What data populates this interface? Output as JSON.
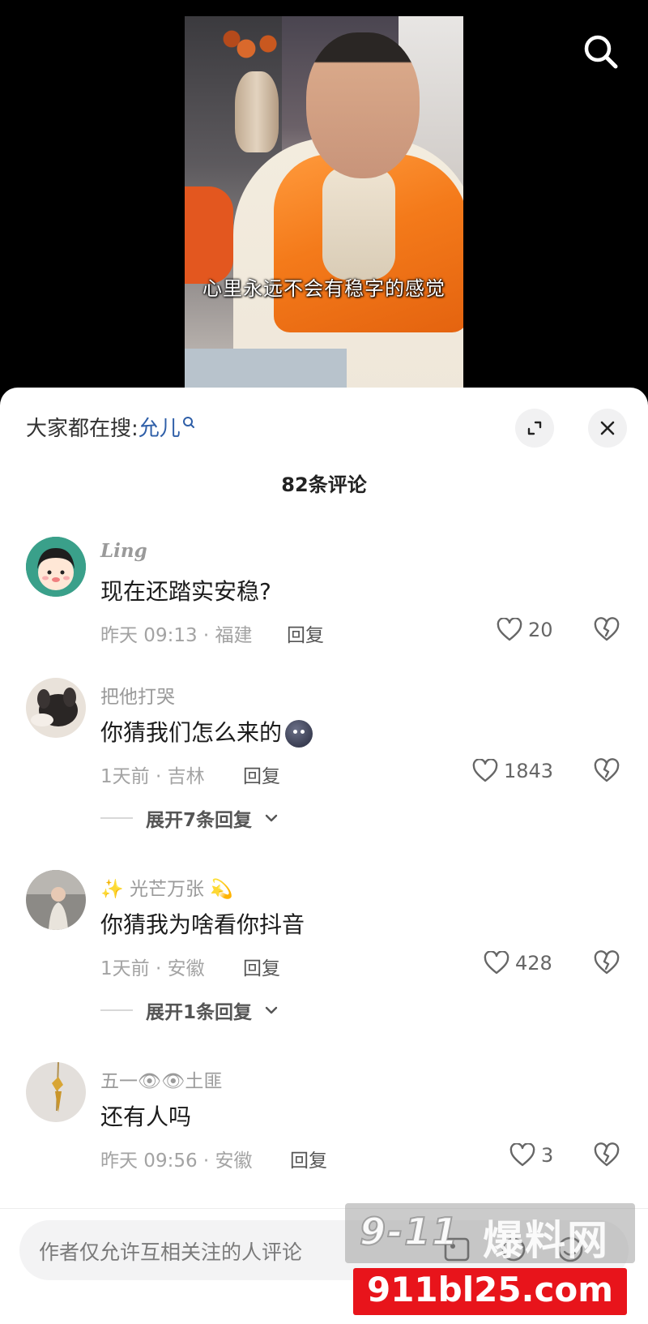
{
  "video": {
    "subtitle": "心里永远不会有稳字的感觉"
  },
  "header": {
    "hot_search_prefix": "大家都在搜:",
    "hot_search_keyword": "允儿",
    "comment_count": "82条评论"
  },
  "comments": [
    {
      "user": "Ling",
      "text": "现在还踏实安稳?",
      "meta": "昨天 09:13 · 福建",
      "reply": "回复",
      "likes": "20"
    },
    {
      "user": "把他打哭",
      "text": "你猜我们怎么来的",
      "meta": "1天前 · 吉林",
      "reply": "回复",
      "likes": "1843",
      "expand": "展开7条回复"
    },
    {
      "user": "✨ 光芒万张 💫",
      "text": "你猜我为啥看你抖音",
      "meta": "1天前 · 安徽",
      "reply": "回复",
      "likes": "428",
      "expand": "展开1条回复"
    },
    {
      "user": "五一👁👁土匪",
      "text": "还有人吗",
      "meta": "昨天 09:56 · 安徽",
      "reply": "回复",
      "likes": "3"
    }
  ],
  "input": {
    "placeholder": "作者仅允许互相关注的人评论"
  },
  "watermark": {
    "logo_num": "9-11",
    "logo_cn": "爆料网",
    "url": "911bl25.com"
  },
  "colors": {
    "keyword_blue": "#2f5fa8",
    "watermark_red": "#e8141b"
  }
}
